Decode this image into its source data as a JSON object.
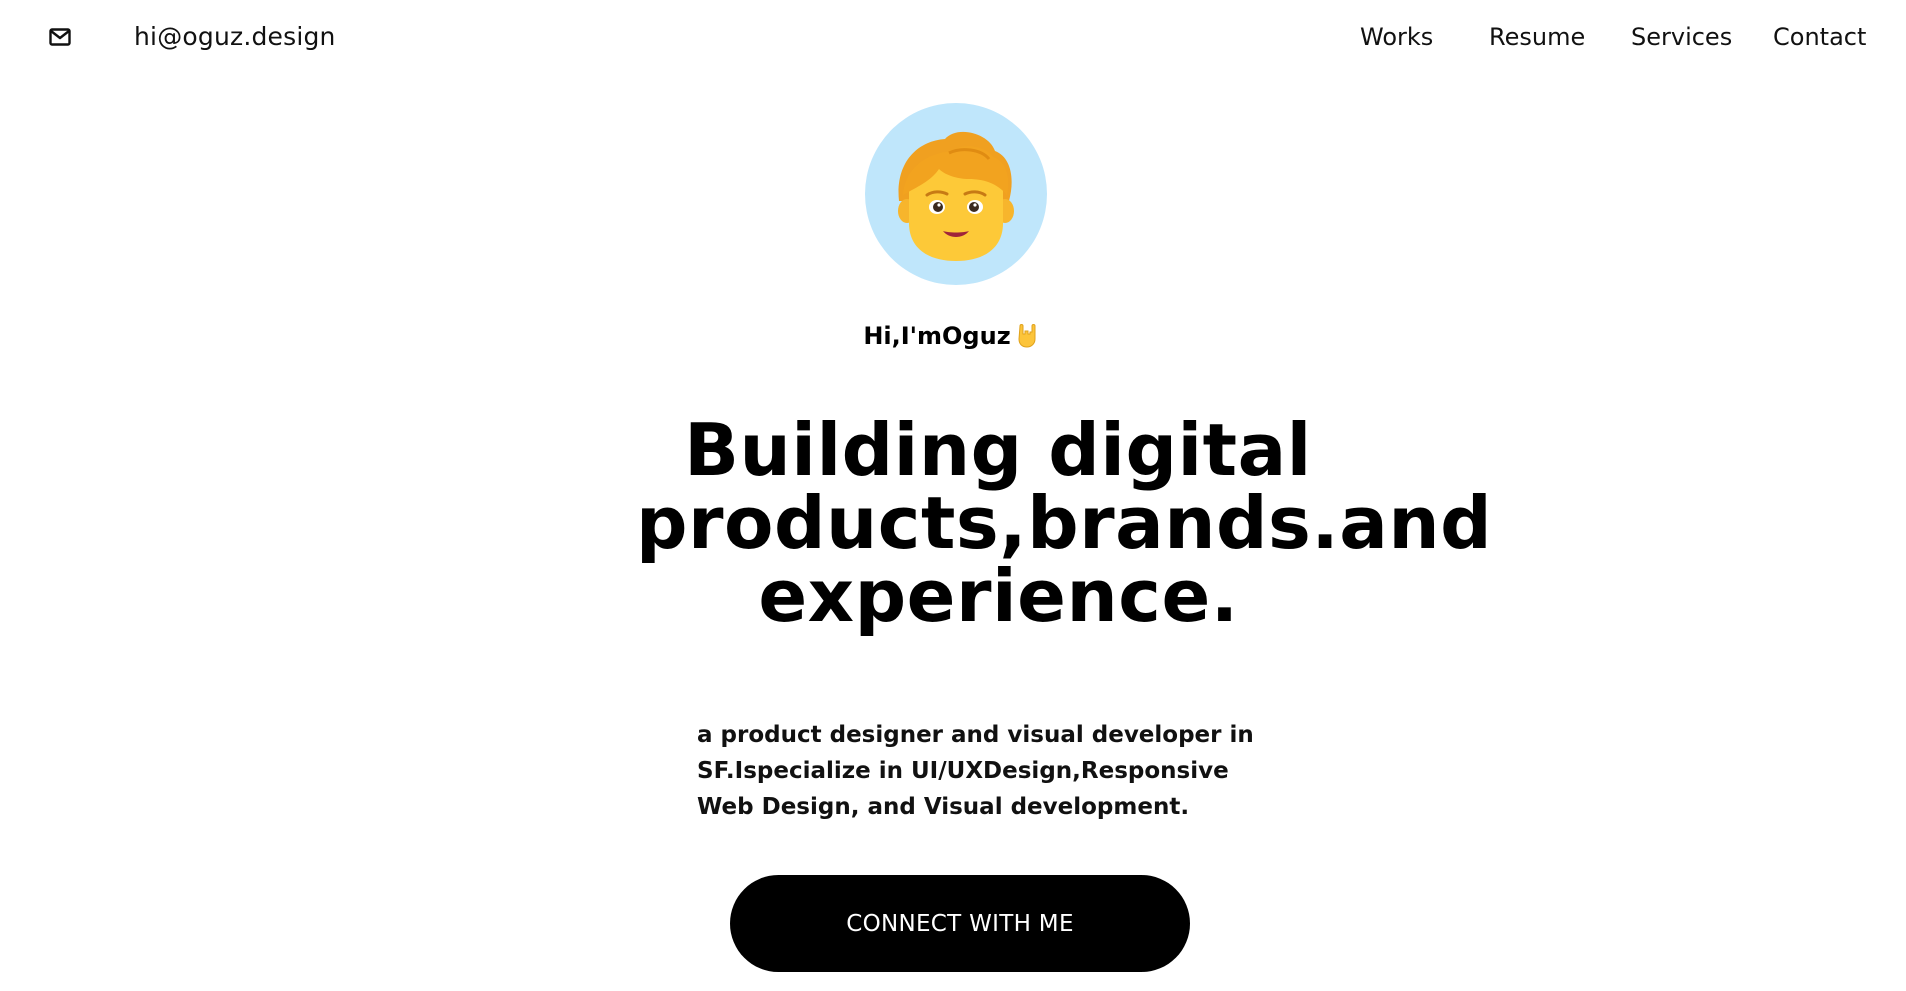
{
  "header": {
    "email": "hi@oguz.design",
    "icon": "mail-icon",
    "nav": [
      {
        "label": "Works"
      },
      {
        "label": "Resume"
      },
      {
        "label": "Services"
      },
      {
        "label": "Contact"
      }
    ]
  },
  "hero": {
    "avatar_icon": "person-emoji-avatar",
    "avatar_bg": "#bfe6fb",
    "greeting": "Hi,I'mOguz",
    "greeting_icon": "sign-of-the-horns-icon",
    "headline_lines": [
      "Building digital",
      "products,brands.and",
      "experience."
    ],
    "description": "a product designer and visual developer in SF.Ispecialize in UI/UXDesign,Responsive Web Design, and Visual development.",
    "cta_label": "CONNECT WITH ME",
    "cta_bg": "#000000"
  }
}
